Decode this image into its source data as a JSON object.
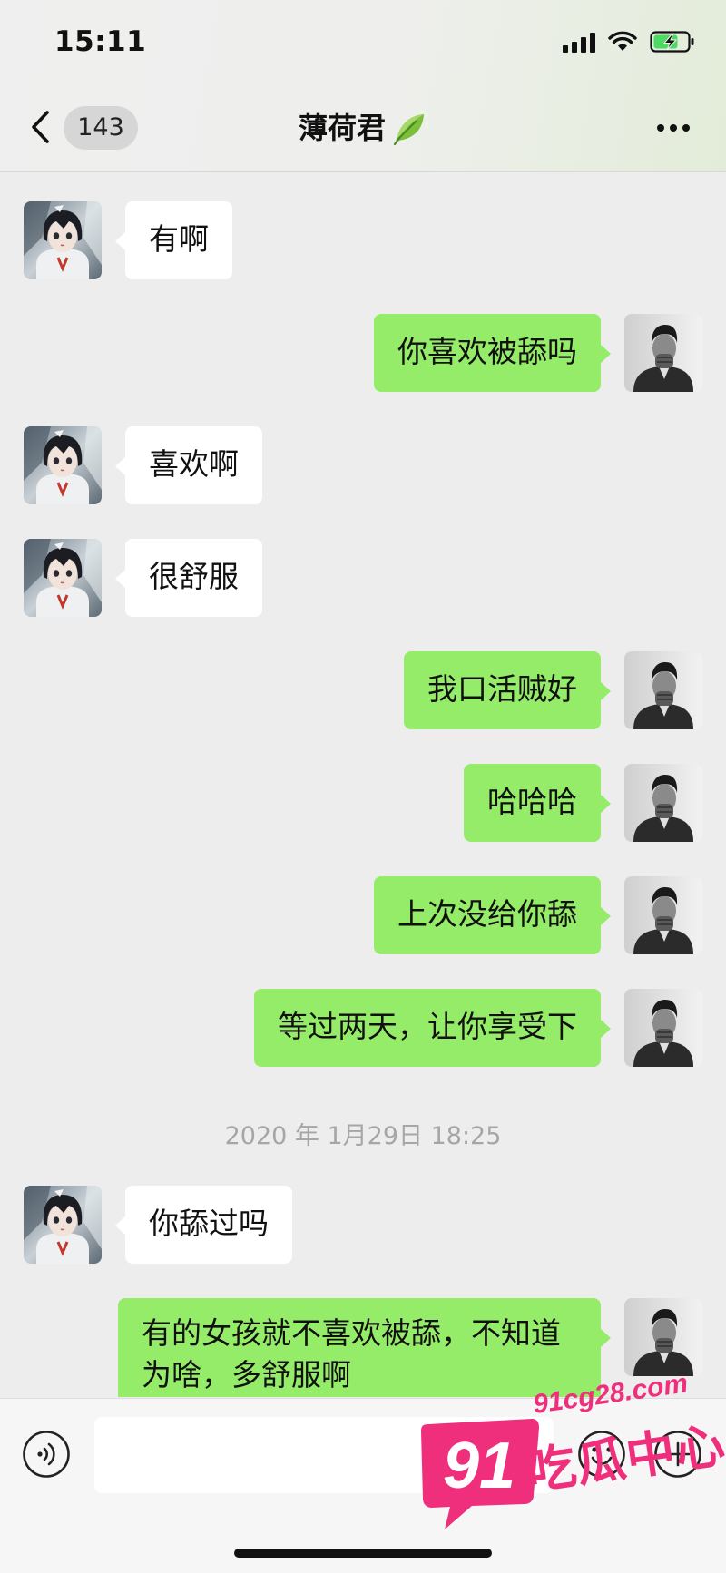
{
  "status_bar": {
    "time": "15:11"
  },
  "header": {
    "back_icon": "chevron-left-icon",
    "unread_count": "143",
    "title": "薄荷君",
    "title_icon": "leaf-icon",
    "more_icon": "more-dots-icon"
  },
  "messages": [
    {
      "side": "in",
      "text": "有啊"
    },
    {
      "side": "out",
      "text": "你喜欢被舔吗"
    },
    {
      "side": "in",
      "text": "喜欢啊"
    },
    {
      "side": "in",
      "text": "很舒服"
    },
    {
      "side": "out",
      "text": "我口活贼好"
    },
    {
      "side": "out",
      "text": "哈哈哈"
    },
    {
      "side": "out",
      "text": "上次没给你舔"
    },
    {
      "side": "out",
      "text": "等过两天，让你享受下"
    },
    {
      "side": "in",
      "text": "你舔过吗"
    },
    {
      "side": "out",
      "text": "有的女孩就不喜欢被舔，不知道为啥，多舒服啊"
    }
  ],
  "timestamp": "2020 年 1月29日 18:25",
  "input_bar": {
    "voice_icon": "voice-icon",
    "input_value": "",
    "emoji_icon": "emoji-icon",
    "plus_icon": "plus-icon"
  },
  "watermark": {
    "number": "91",
    "url": "91cg28.com",
    "text": "吃瓜中心"
  },
  "colors": {
    "chat_background": "#ededed",
    "outgoing_bubble": "#95ec69",
    "incoming_bubble": "#ffffff",
    "watermark": "#ef2f7b"
  }
}
